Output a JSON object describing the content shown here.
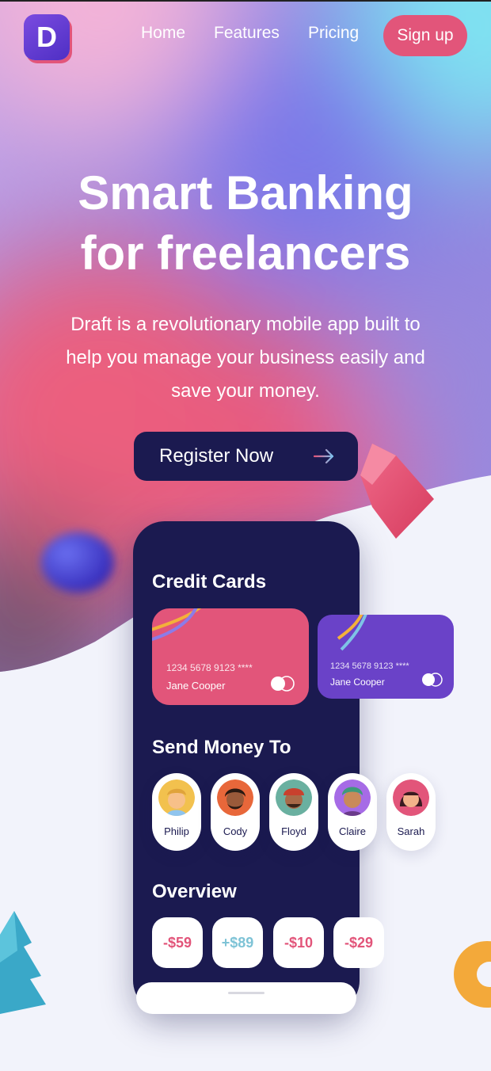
{
  "brand": {
    "logo_letter": "D"
  },
  "nav": {
    "links": [
      "Home",
      "Features",
      "Pricing"
    ],
    "signup_label": "Sign up"
  },
  "hero": {
    "headline_line1": "Smart Banking",
    "headline_line2": "for freelancers",
    "subtext_line1": "Draft is a revolutionary mobile app built to",
    "subtext_line2": "help you manage your business easily and",
    "subtext_line3": "save your money.",
    "cta_label": "Register Now"
  },
  "phone": {
    "credit_cards_title": "Credit Cards",
    "cards": [
      {
        "number": "1234 5678 9123 ****",
        "holder": "Jane Cooper",
        "color": "#e2557a"
      },
      {
        "number": "1234 5678 9123 ****",
        "holder": "Jane Cooper",
        "color": "#6a42c8"
      }
    ],
    "send_money_title": "Send Money To",
    "contacts": [
      {
        "name": "Philip",
        "bg": "#f2c14e",
        "skin": "#f7c089",
        "hair": "#e0a33a"
      },
      {
        "name": "Cody",
        "bg": "#e8673a",
        "skin": "#9a5a3a",
        "hair": "#2b1a12"
      },
      {
        "name": "Floyd",
        "bg": "#6ab0a0",
        "skin": "#a86a48",
        "hair": "#c8412e"
      },
      {
        "name": "Claire",
        "bg": "#a66be6",
        "skin": "#c98a5a",
        "hair": "#3f9a7a"
      },
      {
        "name": "Sarah",
        "bg": "#e2557a",
        "skin": "#f2b28a",
        "hair": "#3a1a20"
      }
    ],
    "overview_title": "Overview",
    "amounts": [
      {
        "label": "-$59",
        "color": "#e2557a"
      },
      {
        "label": "+$89",
        "color": "#7ec3d6"
      },
      {
        "label": "-$10",
        "color": "#e2557a"
      },
      {
        "label": "-$29",
        "color": "#e2557a"
      }
    ]
  },
  "colors": {
    "accent_pink": "#e2557a",
    "navy": "#1b1a50",
    "purple": "#6a42c8"
  }
}
